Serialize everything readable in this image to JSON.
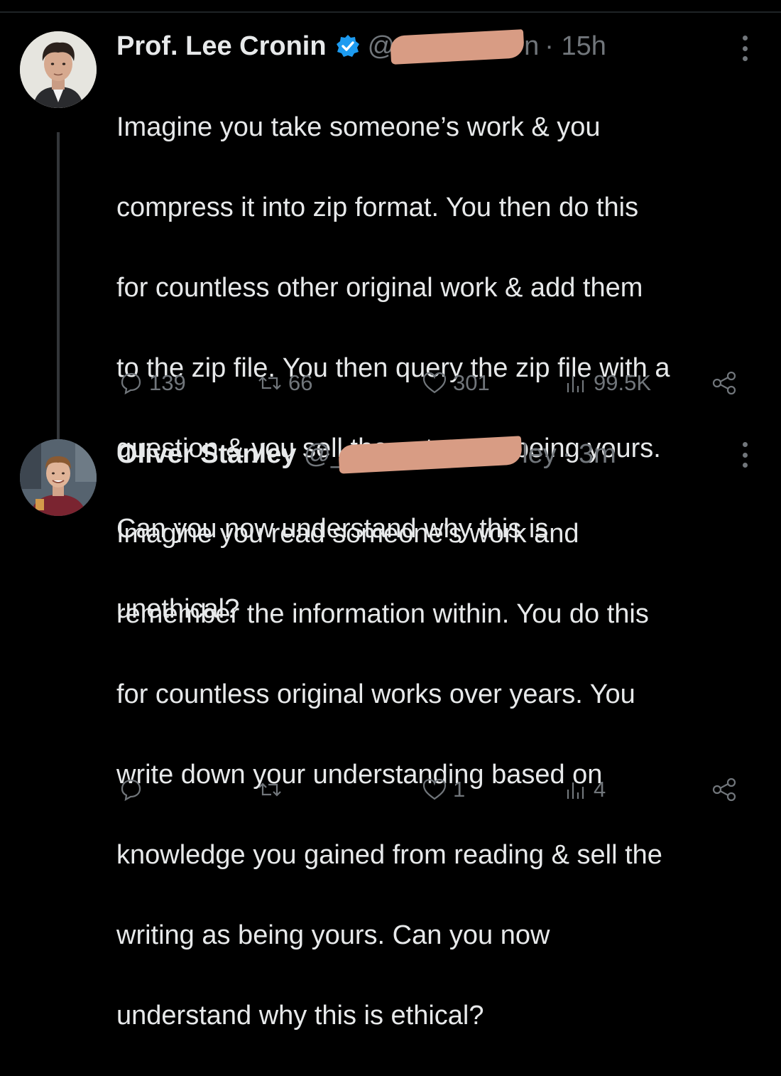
{
  "tweets": [
    {
      "author": "Prof. Lee Cronin",
      "handle_prefix": "@",
      "handle_suffix": "n",
      "time": "· 15h",
      "verified": true,
      "lines": [
        "Imagine you take someone’s work & you",
        "compress it into zip format. You then do this",
        "for countless other original work & add them",
        "to the zip file. You then query the zip file with a",
        "question & you sell the output as being yours.",
        "Can you now understand why this is",
        "unethical?"
      ],
      "stats": {
        "replies": "139",
        "reposts": "66",
        "likes": "301",
        "views": "99.5K"
      }
    },
    {
      "author": "Oliver Stanley",
      "handle_prefix": "@_",
      "handle_suffix": "ley",
      "time": "· 3m",
      "verified": false,
      "lines": [
        "Imagine you read someone's work and",
        "remember the information within. You do this",
        "for countless original works over years. You",
        "write down your understanding based on",
        "knowledge you gained from reading & sell the",
        "writing as being yours. Can you now",
        "understand why this is ethical?"
      ],
      "stats": {
        "replies": "",
        "reposts": "",
        "likes": "1",
        "views": "4"
      }
    }
  ],
  "colors": {
    "background": "#000000",
    "text": "#e7e9ea",
    "muted": "#71767b",
    "verified": "#1d9bf0",
    "redaction": "#d89c84"
  },
  "icons": [
    "reply-icon",
    "repost-icon",
    "like-icon",
    "views-icon",
    "share-icon",
    "more-icon",
    "verified-badge-icon"
  ]
}
